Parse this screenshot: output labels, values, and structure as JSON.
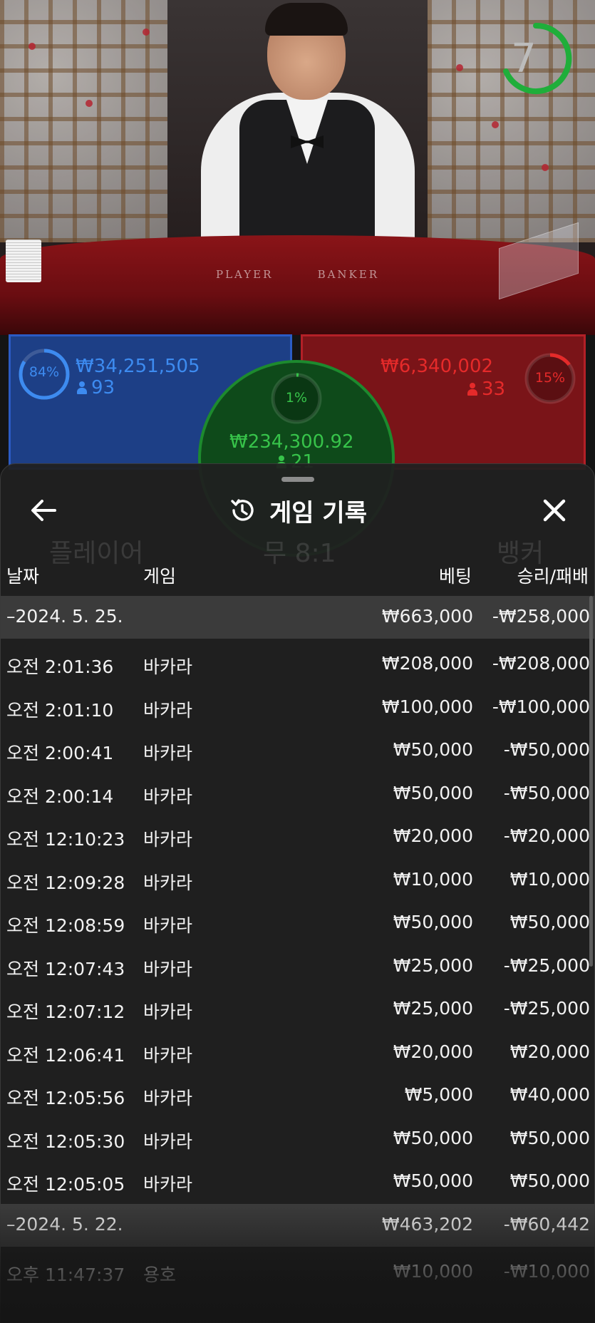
{
  "video": {
    "timer_value": "7",
    "felt_label_left": "PLAYER",
    "felt_label_right": "BANKER"
  },
  "stats": {
    "player": {
      "percent": "84%",
      "amount": "₩34,251,505",
      "players": "93",
      "color": "#3d8bf0"
    },
    "tie": {
      "percent": "1%",
      "amount": "₩234,300.92",
      "players": "21",
      "color": "#37c34a"
    },
    "banker": {
      "percent": "15%",
      "amount": "₩6,340,002",
      "players": "33",
      "color": "#e52a2a"
    }
  },
  "sheet": {
    "title": "게임 기록",
    "back_icon": "arrow-left-icon",
    "close_icon": "close-icon",
    "history_icon": "history-icon",
    "columns": {
      "date": "날짜",
      "game": "게임",
      "bet": "베팅",
      "result": "승리/패배"
    },
    "rows": [
      {
        "type": "date",
        "time": "–2024. 5. 25.",
        "game": "",
        "bet": "₩663,000",
        "result": "-₩258,000"
      },
      {
        "type": "entry",
        "time": "오전 2:01:36",
        "game": "바카라",
        "bet": "₩208,000",
        "result": "-₩208,000"
      },
      {
        "type": "entry",
        "time": "오전 2:01:10",
        "game": "바카라",
        "bet": "₩100,000",
        "result": "-₩100,000"
      },
      {
        "type": "entry",
        "time": "오전 2:00:41",
        "game": "바카라",
        "bet": "₩50,000",
        "result": "-₩50,000"
      },
      {
        "type": "entry",
        "time": "오전 2:00:14",
        "game": "바카라",
        "bet": "₩50,000",
        "result": "-₩50,000"
      },
      {
        "type": "entry",
        "time": "오전 12:10:23",
        "game": "바카라",
        "bet": "₩20,000",
        "result": "-₩20,000"
      },
      {
        "type": "entry",
        "time": "오전 12:09:28",
        "game": "바카라",
        "bet": "₩10,000",
        "result": "₩10,000"
      },
      {
        "type": "entry",
        "time": "오전 12:08:59",
        "game": "바카라",
        "bet": "₩50,000",
        "result": "₩50,000"
      },
      {
        "type": "entry",
        "time": "오전 12:07:43",
        "game": "바카라",
        "bet": "₩25,000",
        "result": "-₩25,000"
      },
      {
        "type": "entry",
        "time": "오전 12:07:12",
        "game": "바카라",
        "bet": "₩25,000",
        "result": "-₩25,000"
      },
      {
        "type": "entry",
        "time": "오전 12:06:41",
        "game": "바카라",
        "bet": "₩20,000",
        "result": "₩20,000"
      },
      {
        "type": "entry",
        "time": "오전 12:05:56",
        "game": "바카라",
        "bet": "₩5,000",
        "result": "₩40,000"
      },
      {
        "type": "entry",
        "time": "오전 12:05:30",
        "game": "바카라",
        "bet": "₩50,000",
        "result": "₩50,000"
      },
      {
        "type": "entry",
        "time": "오전 12:05:05",
        "game": "바카라",
        "bet": "₩50,000",
        "result": "₩50,000"
      },
      {
        "type": "date",
        "time": "–2024. 5. 22.",
        "game": "",
        "bet": "₩463,202",
        "result": "-₩60,442"
      },
      {
        "type": "entry",
        "time": "오후 11:47:37",
        "game": "용호",
        "bet": "₩10,000",
        "result": "-₩10,000"
      }
    ]
  },
  "ghost": {
    "player_label": "플레이어",
    "tie_label": "무 8:1",
    "banker_label": "뱅커"
  }
}
